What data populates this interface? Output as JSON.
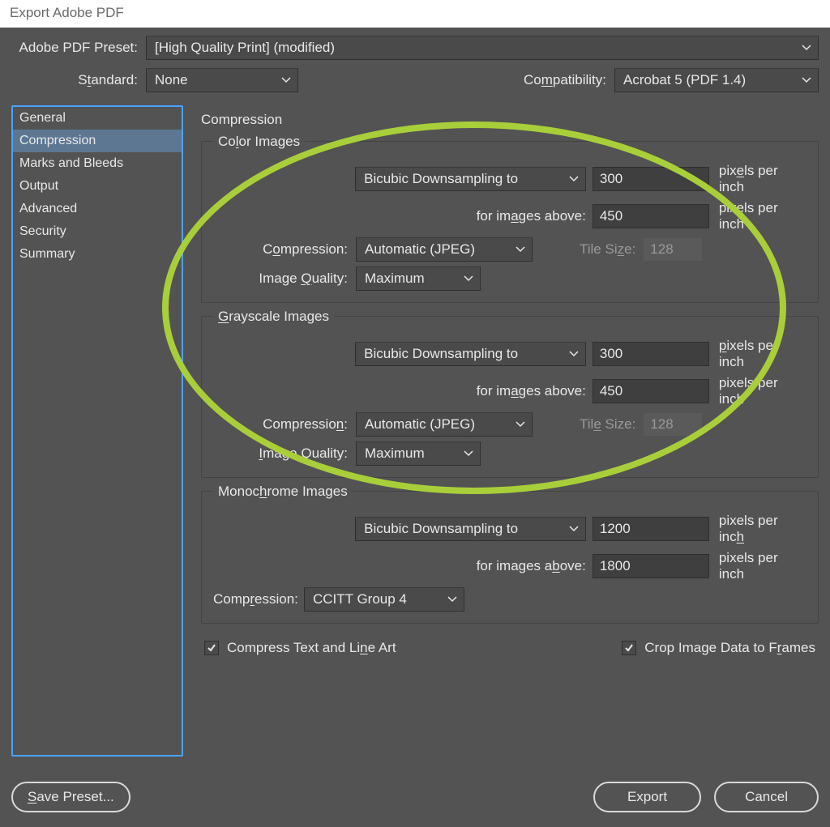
{
  "titlebar": "Export Adobe PDF",
  "labels": {
    "preset": "Adobe PDF Preset:",
    "standard_pre": "S",
    "standard_u": "t",
    "standard_post": "andard:",
    "compat_pre": "Co",
    "compat_u": "m",
    "compat_post": "patibility:"
  },
  "selects": {
    "preset": "[High Quality Print] (modified)",
    "standard": "None",
    "compat": "Acrobat 5 (PDF 1.4)"
  },
  "sidebar": {
    "items": [
      "General",
      "Compression",
      "Marks and Bleeds",
      "Output",
      "Advanced",
      "Security",
      "Summary"
    ]
  },
  "main_title": "Compression",
  "color": {
    "legend_pre": "Co",
    "legend_u": "l",
    "legend_post": "or Images",
    "downsample": "Bicubic Downsampling to",
    "ppi1": "300",
    "unit1_pre": "pix",
    "unit1_u": "e",
    "unit1_post": "ls per inch",
    "above_pre": "for im",
    "above_u": "a",
    "above_post": "ges above:",
    "ppi2": "450",
    "unit2": "pixels per inch",
    "compress_lbl_pre": "C",
    "compress_lbl_u": "o",
    "compress_lbl_post": "mpression:",
    "compress_val": "Automatic (JPEG)",
    "tile_lbl_pre": "Tile Si",
    "tile_lbl_u": "z",
    "tile_lbl_post": "e:",
    "tile_val": "128",
    "quality_lbl_pre": "Image ",
    "quality_lbl_u": "Q",
    "quality_lbl_post": "uality:",
    "quality_val": "Maximum"
  },
  "gray": {
    "legend_pre": "",
    "legend_u": "G",
    "legend_post": "rayscale Images",
    "downsample": "Bicubic Downsampling to",
    "ppi1": "300",
    "unit1_pre": "",
    "unit1_u": "p",
    "unit1_post": "ixels per inch",
    "above_pre": "for im",
    "above_u": "a",
    "above_post": "ges above:",
    "ppi2": "450",
    "unit2": "pixels per inch",
    "compress_lbl_pre": "Compressio",
    "compress_lbl_u": "n",
    "compress_lbl_post": ":",
    "compress_val": "Automatic (JPEG)",
    "tile_lbl_pre": "Til",
    "tile_lbl_u": "e",
    "tile_lbl_post": " Size:",
    "tile_val": "128",
    "quality_lbl_pre": "",
    "quality_lbl_u": "I",
    "quality_lbl_post": "mage Quality:",
    "quality_val": "Maximum"
  },
  "mono": {
    "legend_pre": "Monoc",
    "legend_u": "h",
    "legend_post": "rome Images",
    "downsample": "Bicubic Downsampling to",
    "ppi1": "1200",
    "unit1_pre": "pixels per inc",
    "unit1_u": "h",
    "unit1_post": "",
    "above_pre": "for images a",
    "above_u": "b",
    "above_post": "ove:",
    "ppi2": "1800",
    "unit2": "pixels per inch",
    "compress_lbl_pre": "Comp",
    "compress_lbl_u": "r",
    "compress_lbl_post": "ession:",
    "compress_val": "CCITT Group 4"
  },
  "checks": {
    "compress_text_pre": "Compress Text and Li",
    "compress_text_u": "n",
    "compress_text_post": "e Art",
    "crop_pre": "Crop Image Data to F",
    "crop_u": "r",
    "crop_post": "ames"
  },
  "buttons": {
    "save_pre": "",
    "save_u": "S",
    "save_post": "ave Preset...",
    "export": "Export",
    "cancel": "Cancel"
  },
  "annotation": {
    "accent": "#a8cf3a"
  }
}
